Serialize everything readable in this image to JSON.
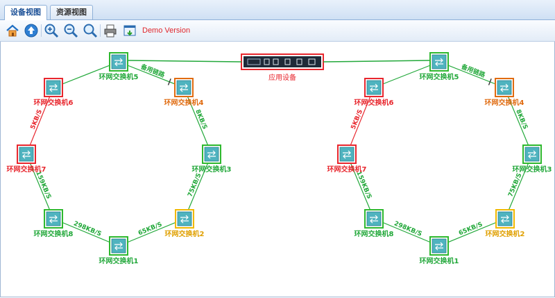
{
  "tabs": [
    {
      "label": "设备视图",
      "active": true
    },
    {
      "label": "资源视图",
      "active": false
    }
  ],
  "toolbar": {
    "buttons": [
      {
        "name": "home-icon"
      },
      {
        "name": "up-icon"
      },
      {
        "name": "zoom-in-icon"
      },
      {
        "name": "zoom-out-icon"
      },
      {
        "name": "zoom-fit-icon"
      },
      {
        "name": "print-icon"
      },
      {
        "name": "export-icon"
      }
    ],
    "demo_label": "Demo Version"
  },
  "colors": {
    "green": "#2eb82e",
    "red": "#e8262d",
    "orange": "#e06b10",
    "yellow": "#f0b800",
    "link_green": "#22a83a",
    "link_red": "#e8262d",
    "device_border": "#e8262d"
  },
  "device": {
    "label": "应用设备"
  },
  "rings": [
    {
      "switches": [
        {
          "id": "s5",
          "label": "环网交换机5",
          "status": "green"
        },
        {
          "id": "s4",
          "label": "环网交换机4",
          "status": "orange"
        },
        {
          "id": "s3",
          "label": "环网交换机3",
          "status": "green"
        },
        {
          "id": "s2",
          "label": "环网交换机2",
          "status": "yellow"
        },
        {
          "id": "s1",
          "label": "环网交换机1",
          "status": "green"
        },
        {
          "id": "s8",
          "label": "环网交换机8",
          "status": "green"
        },
        {
          "id": "s7",
          "label": "环网交换机7",
          "status": "red"
        },
        {
          "id": "s6",
          "label": "环网交换机6",
          "status": "red"
        }
      ],
      "links": [
        {
          "from": "s5",
          "to": "s4",
          "label": "备用链路",
          "color": "green",
          "style": "backup"
        },
        {
          "from": "s4",
          "to": "s3",
          "label": "8KB/S",
          "color": "green"
        },
        {
          "from": "s3",
          "to": "s2",
          "label": "75KB/S",
          "color": "green"
        },
        {
          "from": "s2",
          "to": "s1",
          "label": "65KB/S",
          "color": "green"
        },
        {
          "from": "s1",
          "to": "s8",
          "label": "298KB/S",
          "color": "green"
        },
        {
          "from": "s8",
          "to": "s7",
          "label": "159KB/S",
          "color": "green"
        },
        {
          "from": "s7",
          "to": "s6",
          "label": "5KB/S",
          "color": "red"
        },
        {
          "from": "s6",
          "to": "s5",
          "label": "",
          "color": "green"
        }
      ]
    },
    {
      "switches": [
        {
          "id": "s5",
          "label": "环网交换机5",
          "status": "green"
        },
        {
          "id": "s4",
          "label": "环网交换机4",
          "status": "orange"
        },
        {
          "id": "s3",
          "label": "环网交换机3",
          "status": "green"
        },
        {
          "id": "s2",
          "label": "环网交换机2",
          "status": "yellow"
        },
        {
          "id": "s1",
          "label": "环网交换机1",
          "status": "green"
        },
        {
          "id": "s8",
          "label": "环网交换机8",
          "status": "green"
        },
        {
          "id": "s7",
          "label": "环网交换机7",
          "status": "red"
        },
        {
          "id": "s6",
          "label": "环网交换机6",
          "status": "red"
        }
      ],
      "links": [
        {
          "from": "s5",
          "to": "s4",
          "label": "备用链路",
          "color": "green",
          "style": "backup"
        },
        {
          "from": "s4",
          "to": "s3",
          "label": "8KB/S",
          "color": "green"
        },
        {
          "from": "s3",
          "to": "s2",
          "label": "75KB/S",
          "color": "green"
        },
        {
          "from": "s2",
          "to": "s1",
          "label": "65KB/S",
          "color": "green"
        },
        {
          "from": "s1",
          "to": "s8",
          "label": "298KB/S",
          "color": "green"
        },
        {
          "from": "s8",
          "to": "s7",
          "label": "159KB/S",
          "color": "green"
        },
        {
          "from": "s7",
          "to": "s6",
          "label": "5KB/S",
          "color": "red"
        },
        {
          "from": "s6",
          "to": "s5",
          "label": "",
          "color": "green"
        }
      ]
    }
  ]
}
